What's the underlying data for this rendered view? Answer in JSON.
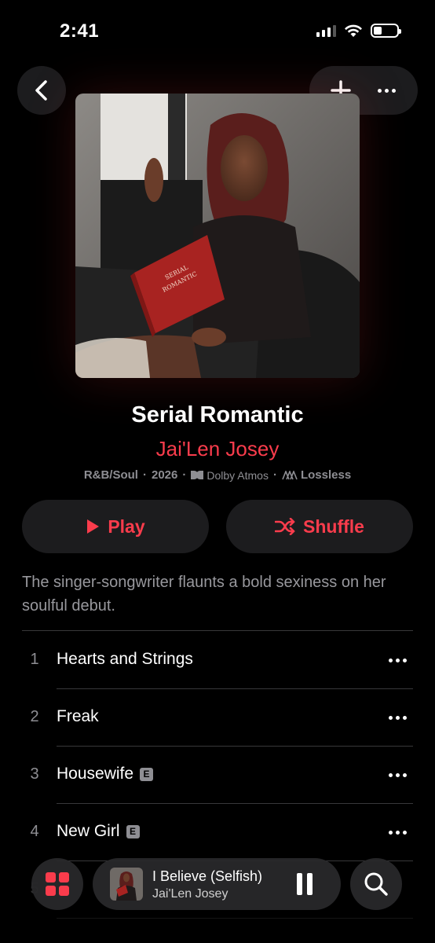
{
  "status_bar": {
    "time": "2:41",
    "battery_level": 0.35
  },
  "album": {
    "title": "Serial Romantic",
    "artist": "Jai'Len Josey",
    "genre": "R&B/Soul",
    "year": "2026",
    "dolby_label": "Dolby Atmos",
    "lossless_label": "Lossless",
    "description": "The singer-songwriter flaunts a bold sexiness on her soulful debut.",
    "artwork_book_text": "SERIAL ROMANTIC"
  },
  "actions": {
    "play_label": "Play",
    "shuffle_label": "Shuffle"
  },
  "tracks": [
    {
      "number": "1",
      "title": "Hearts and Strings",
      "explicit": false
    },
    {
      "number": "2",
      "title": "Freak",
      "explicit": false
    },
    {
      "number": "3",
      "title": "Housewife",
      "explicit": true
    },
    {
      "number": "4",
      "title": "New Girl",
      "explicit": true
    },
    {
      "number": "5",
      "title": "",
      "explicit": false
    }
  ],
  "explicit_badge": "E",
  "now_playing": {
    "title": "I Believe (Selfish)",
    "artist": "Jai'Len Josey"
  },
  "colors": {
    "accent": "#fa3c4c",
    "background": "#000000",
    "button_bg": "#1c1c1e",
    "secondary_text": "#8e8e93"
  }
}
